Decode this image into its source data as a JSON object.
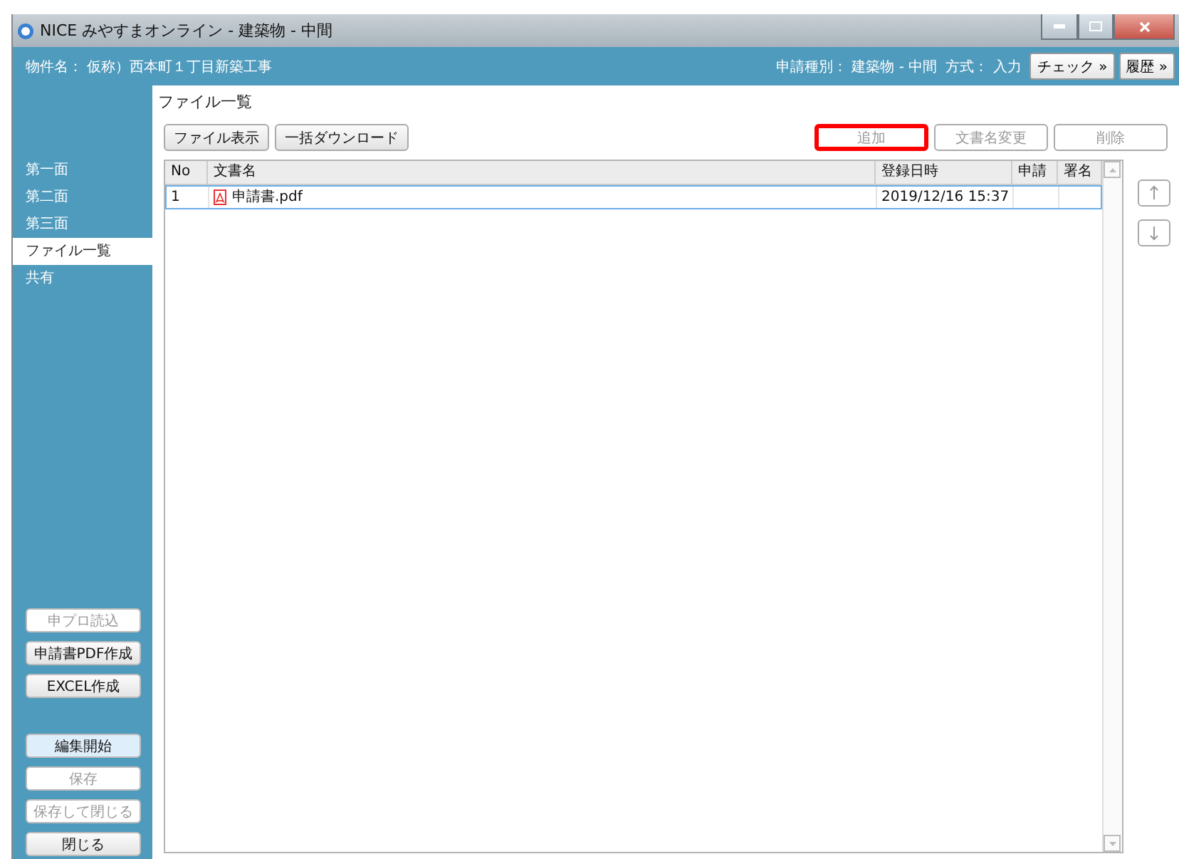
{
  "window": {
    "title": "NICE みやすまオンライン - 建築物 - 中間"
  },
  "header": {
    "property": "物件名： 仮称）西本町１丁目新築工事",
    "application_type": "申請種別： 建築物 - 中間",
    "method": "方式： 入力",
    "buttons": [
      "チェック »",
      "履歴 »"
    ]
  },
  "sidebar": {
    "items": [
      {
        "label": "第一面",
        "selected": false
      },
      {
        "label": "第二面",
        "selected": false
      },
      {
        "label": "第三面",
        "selected": false
      },
      {
        "label": "ファイル一覧",
        "selected": true
      },
      {
        "label": "共有",
        "selected": false
      }
    ],
    "tool_buttons": [
      {
        "label": "申プロ読込",
        "disabled": true,
        "active": false
      },
      {
        "label": "申請書PDF作成",
        "disabled": false,
        "active": false
      },
      {
        "label": "EXCEL作成",
        "disabled": false,
        "active": false
      }
    ],
    "edit_buttons": [
      {
        "label": "編集開始",
        "disabled": false,
        "active": true
      },
      {
        "label": "保存",
        "disabled": true,
        "active": false
      },
      {
        "label": "保存して閉じる",
        "disabled": true,
        "active": false
      },
      {
        "label": "閉じる",
        "disabled": false,
        "active": false
      }
    ]
  },
  "content": {
    "title": "ファイル一覧",
    "left_buttons": [
      {
        "label": "ファイル表示",
        "disabled": false,
        "highlighted": false
      },
      {
        "label": "一括ダウンロード",
        "disabled": false,
        "highlighted": false
      }
    ],
    "right_buttons": [
      {
        "label": "追加",
        "disabled": true,
        "highlighted": true
      },
      {
        "label": "文書名変更",
        "disabled": true,
        "highlighted": false
      },
      {
        "label": "削除",
        "disabled": true,
        "highlighted": false
      }
    ],
    "table": {
      "columns": [
        "No",
        "文書名",
        "登録日時",
        "申請",
        "署名"
      ],
      "rows": [
        {
          "no": "1",
          "name": "申請書.pdf",
          "date": "2019/12/16 15:37",
          "applied": "",
          "signed": "",
          "selected": true
        }
      ]
    }
  }
}
